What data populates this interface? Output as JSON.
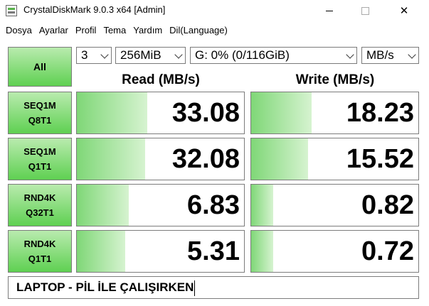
{
  "window": {
    "title": "CrystalDiskMark 9.0.3 x64 [Admin]",
    "icon": "crystaldiskmark-icon"
  },
  "menu": [
    "Dosya",
    "Ayarlar",
    "Profil",
    "Tema",
    "Yardım",
    "Dil(Language)"
  ],
  "controls": {
    "all_label": "All",
    "count": "3",
    "size": "256MiB",
    "drive": "G: 0% (0/116GiB)",
    "unit": "MB/s"
  },
  "headers": {
    "read": "Read (MB/s)",
    "write": "Write (MB/s)"
  },
  "tests": [
    {
      "line1": "SEQ1M",
      "line2": "Q8T1",
      "read": "33.08",
      "write": "18.23",
      "read_level": 0.42,
      "write_level": 0.36
    },
    {
      "line1": "SEQ1M",
      "line2": "Q1T1",
      "read": "32.08",
      "write": "15.52",
      "read_level": 0.41,
      "write_level": 0.34
    },
    {
      "line1": "RND4K",
      "line2": "Q32T1",
      "read": "6.83",
      "write": "0.82",
      "read_level": 0.31,
      "write_level": 0.13
    },
    {
      "line1": "RND4K",
      "line2": "Q1T1",
      "read": "5.31",
      "write": "0.72",
      "read_level": 0.29,
      "write_level": 0.13
    }
  ],
  "comment": "LAPTOP - PİL İLE ÇALIŞIRKEN",
  "colors": {
    "button_top": "#b9ebae",
    "button_bottom": "#5fd052",
    "bar": "#7fd777"
  }
}
